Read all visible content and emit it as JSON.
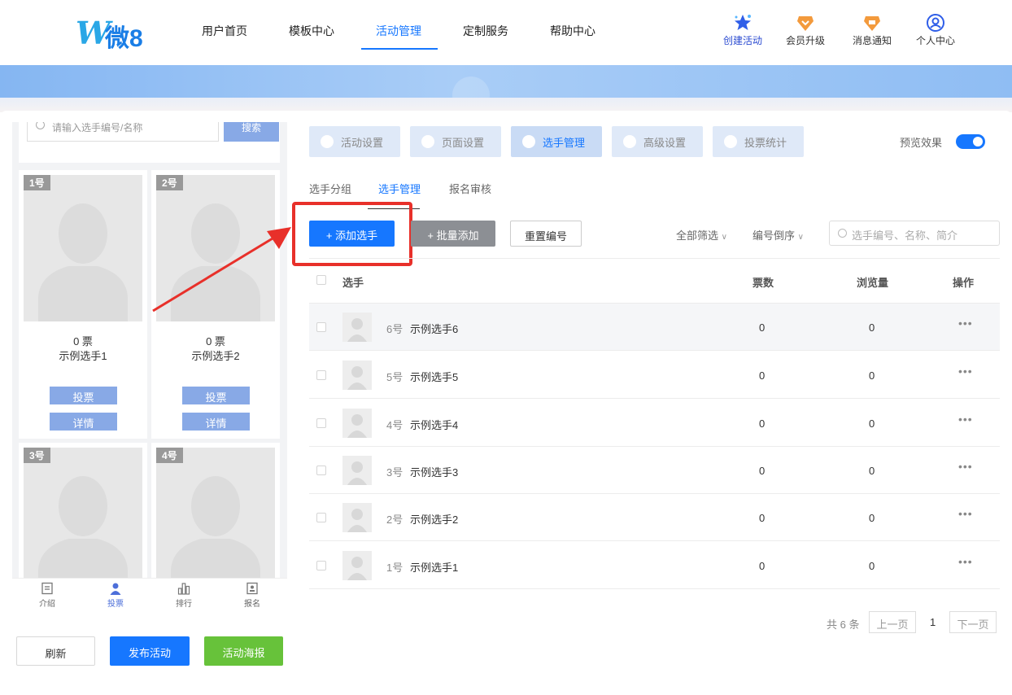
{
  "header": {
    "logo_text": "微8",
    "nav": [
      {
        "label": "用户首页"
      },
      {
        "label": "模板中心"
      },
      {
        "label": "活动管理",
        "active": true
      },
      {
        "label": "定制服务"
      },
      {
        "label": "帮助中心"
      }
    ],
    "actions": [
      {
        "label": "创建活动",
        "icon": "star-icon"
      },
      {
        "label": "会员升级",
        "icon": "vip-badge-icon"
      },
      {
        "label": "消息通知",
        "icon": "bell-badge-icon"
      },
      {
        "label": "个人中心",
        "icon": "user-circle-icon"
      }
    ]
  },
  "preview": {
    "search_placeholder": "请输入选手编号/名称",
    "search_button": "搜索",
    "cards": [
      {
        "num": "1号",
        "votes": "0 票",
        "name": "示例选手1"
      },
      {
        "num": "2号",
        "votes": "0 票",
        "name": "示例选手2"
      },
      {
        "num": "3号"
      },
      {
        "num": "4号"
      }
    ],
    "vote_label": "投票",
    "detail_label": "详情",
    "bottom_tabs": [
      {
        "label": "介绍",
        "icon": "document-icon"
      },
      {
        "label": "投票",
        "icon": "person-icon",
        "active": true
      },
      {
        "label": "排行",
        "icon": "bar-chart-icon"
      },
      {
        "label": "报名",
        "icon": "id-card-icon"
      }
    ]
  },
  "left_actions": {
    "refresh": "刷新",
    "publish": "发布活动",
    "poster": "活动海报"
  },
  "settings_tabs": [
    {
      "label": "活动设置"
    },
    {
      "label": "页面设置"
    },
    {
      "label": "选手管理",
      "active": true
    },
    {
      "label": "高级设置"
    },
    {
      "label": "投票统计"
    }
  ],
  "preview_toggle": {
    "label": "预览效果",
    "on": true
  },
  "subtabs": [
    {
      "label": "选手分组"
    },
    {
      "label": "选手管理",
      "active": true
    },
    {
      "label": "报名审核"
    }
  ],
  "toolbar": {
    "add": "+ 添加选手",
    "batch_add": "+ 批量添加",
    "renumber": "重置编号",
    "filter_all": "全部筛选",
    "sort_order": "编号倒序",
    "search_placeholder": "选手编号、名称、简介"
  },
  "table": {
    "headers": {
      "player": "选手",
      "votes": "票数",
      "views": "浏览量",
      "ops": "操作"
    },
    "rows": [
      {
        "num": "6号",
        "name": "示例选手6",
        "votes": "0",
        "views": "0",
        "more": "•••"
      },
      {
        "num": "5号",
        "name": "示例选手5",
        "votes": "0",
        "views": "0",
        "more": "•••"
      },
      {
        "num": "4号",
        "name": "示例选手4",
        "votes": "0",
        "views": "0",
        "more": "•••"
      },
      {
        "num": "3号",
        "name": "示例选手3",
        "votes": "0",
        "views": "0",
        "more": "•••"
      },
      {
        "num": "2号",
        "name": "示例选手2",
        "votes": "0",
        "views": "0",
        "more": "•••"
      },
      {
        "num": "1号",
        "name": "示例选手1",
        "votes": "0",
        "views": "0",
        "more": "•••"
      }
    ]
  },
  "pagination": {
    "total": "共 6 条",
    "prev": "上一页",
    "current": "1",
    "next": "下一页"
  },
  "colors": {
    "primary": "#1677ff",
    "highlight": "#e8302a",
    "poster": "#67c23a",
    "batch": "#8c8f94"
  }
}
